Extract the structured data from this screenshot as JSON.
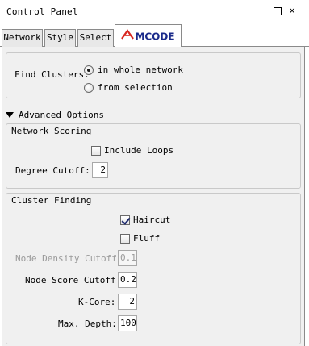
{
  "window": {
    "title": "Control Panel",
    "maximize_label": "",
    "close_label": "✕"
  },
  "tabs": [
    {
      "label": "Network"
    },
    {
      "label": "Style"
    },
    {
      "label": "Select"
    },
    {
      "label": "MCODE",
      "active": true,
      "logo_color": "#d8261f"
    }
  ],
  "find_clusters": {
    "label": "Find Clusters:",
    "options": [
      {
        "label": "in whole network",
        "checked": true
      },
      {
        "label": "from selection",
        "checked": false
      }
    ]
  },
  "advanced": {
    "label": "Advanced Options",
    "expanded": true
  },
  "network_scoring": {
    "title": "Network Scoring",
    "include_loops": {
      "label": "Include Loops",
      "checked": false
    },
    "degree_cutoff": {
      "label": "Degree Cutoff:",
      "value": "2"
    }
  },
  "cluster_finding": {
    "title": "Cluster Finding",
    "haircut": {
      "label": "Haircut",
      "checked": true
    },
    "fluff": {
      "label": "Fluff",
      "checked": false
    },
    "node_density_cutoff": {
      "label": "Node Density Cutoff:",
      "value": "0.1",
      "disabled": true
    },
    "node_score_cutoff": {
      "label": "Node Score Cutoff:",
      "value": "0.2"
    },
    "k_core": {
      "label": "K-Core:",
      "value": "2"
    },
    "max_depth": {
      "label": "Max. Depth:",
      "value": "100"
    }
  }
}
